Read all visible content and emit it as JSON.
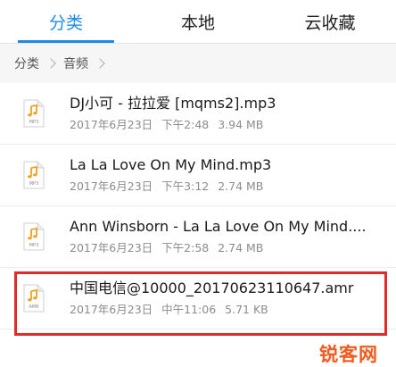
{
  "tabs": [
    {
      "label": "分类",
      "active": true
    },
    {
      "label": "本地",
      "active": false
    },
    {
      "label": "云收藏",
      "active": false
    }
  ],
  "breadcrumb": [
    "分类",
    "音频"
  ],
  "files": [
    {
      "name": "DJ小可 - 拉拉爱 [mqms2].mp3",
      "date": "2017年6月23日",
      "time": "下午2:48",
      "size": "3.94 MB",
      "icon_label": "MP3"
    },
    {
      "name": "La La Love On My Mind.mp3",
      "date": "2017年6月23日",
      "time": "下午3:12",
      "size": "2.74 MB",
      "icon_label": "MP3"
    },
    {
      "name": "Ann Winsborn - La La Love On My Mind....",
      "date": "2017年6月23日",
      "time": "下午2:58",
      "size": "2.74 MB",
      "icon_label": "MP3"
    },
    {
      "name": "中国电信@10000_20170623110647.amr",
      "date": "2017年6月23日",
      "time": "中午11:06",
      "size": "5.71 KB",
      "icon_label": "AMR"
    }
  ],
  "watermark": "锐客网",
  "colors": {
    "accent": "#1e8ce6",
    "icon": "#f0a020",
    "highlight": "#e02b2b"
  }
}
